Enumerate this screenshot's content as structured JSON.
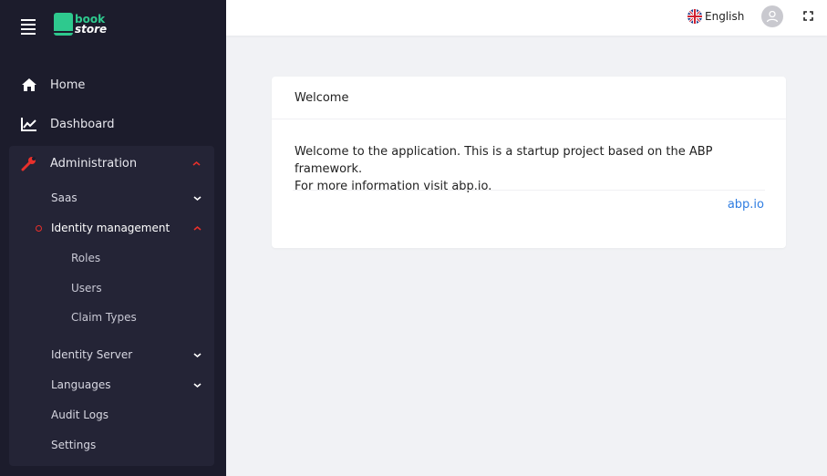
{
  "app": {
    "logo_line1": "book",
    "logo_line2": "store"
  },
  "sidebar": {
    "items": [
      {
        "label": "Home",
        "icon": "home-icon"
      },
      {
        "label": "Dashboard",
        "icon": "chart-line-icon"
      },
      {
        "label": "Administration",
        "icon": "wrench-icon",
        "expanded": true
      }
    ],
    "admin_children": [
      {
        "label": "Saas",
        "expandable": true
      },
      {
        "label": "Identity management",
        "expandable": true,
        "expanded": true
      },
      {
        "label": "Identity Server",
        "expandable": true
      },
      {
        "label": "Languages",
        "expandable": true
      },
      {
        "label": "Audit Logs"
      },
      {
        "label": "Settings"
      }
    ],
    "identity_children": [
      {
        "label": "Roles"
      },
      {
        "label": "Users"
      },
      {
        "label": "Claim Types"
      }
    ]
  },
  "topbar": {
    "language": "English",
    "language_icon": "uk-flag-icon"
  },
  "card": {
    "title": "Welcome",
    "body_line1": "Welcome to the application. This is a startup project based on the ABP framework.",
    "body_line2": "For more information visit abp.io.",
    "link": "abp.io"
  },
  "colors": {
    "sidebar_bg": "#1c1c2c",
    "accent_red": "#e8302b",
    "logo_green": "#2ec98e",
    "link_blue": "#2f7de1"
  }
}
